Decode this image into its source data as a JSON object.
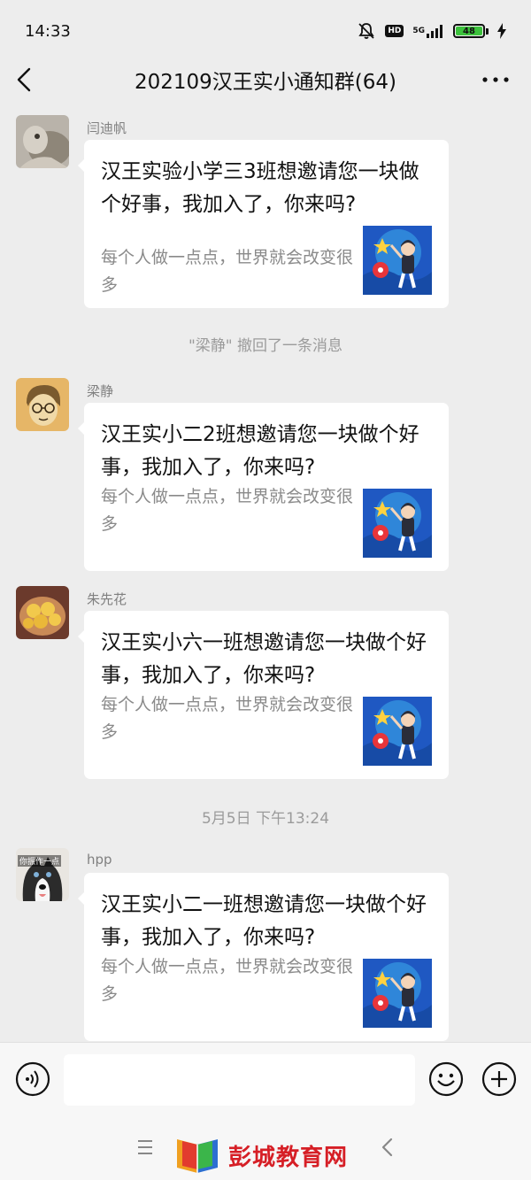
{
  "status_bar": {
    "time": "14:33",
    "network": "5G",
    "hd": "HD",
    "battery": "48"
  },
  "header": {
    "title": "202109汉王实小通知群(64)"
  },
  "messages": [
    {
      "sender": "闫迪帆",
      "title": "汉王实验小学三3班想邀请您一块做个好事，我加入了，你来吗?",
      "desc": "每个人做一点点，世界就会改变很多"
    },
    {
      "sender": "梁静",
      "title": "汉王实小二2班想邀请您一块做个好事，我加入了，你来吗?",
      "desc": "每个人做一点点，世界就会改变很多"
    },
    {
      "sender": "朱先花",
      "title": "汉王实小六一班想邀请您一块做个好事，我加入了，你来吗?",
      "desc": "每个人做一点点，世界就会改变很多"
    },
    {
      "sender": "hpp",
      "title": "汉王实小二一班想邀请您一块做个好事，我加入了，你来吗?",
      "desc": "每个人做一点点，世界就会改变很多"
    }
  ],
  "system_notes": {
    "recall": "\"梁静\" 撤回了一条消息",
    "timestamp": "5月5日 下午13:24"
  },
  "avatar_hpp_caption": "你振作一点",
  "watermark": {
    "text": "彭城教育网"
  },
  "colors": {
    "background": "#ededed",
    "card": "#ffffff",
    "accent_red": "#d61f26"
  }
}
